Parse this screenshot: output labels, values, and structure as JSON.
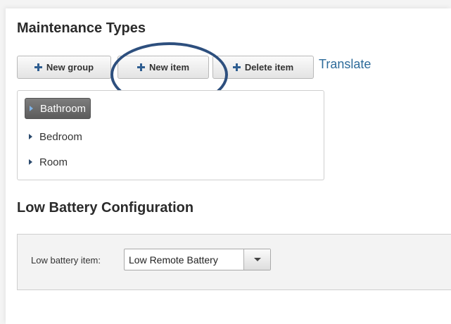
{
  "maintenance": {
    "title": "Maintenance Types",
    "buttons": {
      "new_group": "New group",
      "new_item": "New item",
      "delete_item": "Delete item"
    },
    "translate_link": "Translate",
    "tree": {
      "items": [
        {
          "label": "Bathroom",
          "selected": true
        },
        {
          "label": "Bedroom",
          "selected": false
        },
        {
          "label": "Room",
          "selected": false
        }
      ]
    }
  },
  "low_battery": {
    "title": "Low Battery Configuration",
    "field_label": "Low battery item:",
    "selected_value": "Low Remote Battery"
  },
  "icons": {
    "add": "plus-icon",
    "expand": "caret-right-icon",
    "dropdown": "chevron-down-icon"
  },
  "colors": {
    "accent": "#2f5e91",
    "link": "#2d6b9a",
    "annotation": "#2d4f7e",
    "selected_node_bg": "#6b6b6b"
  }
}
